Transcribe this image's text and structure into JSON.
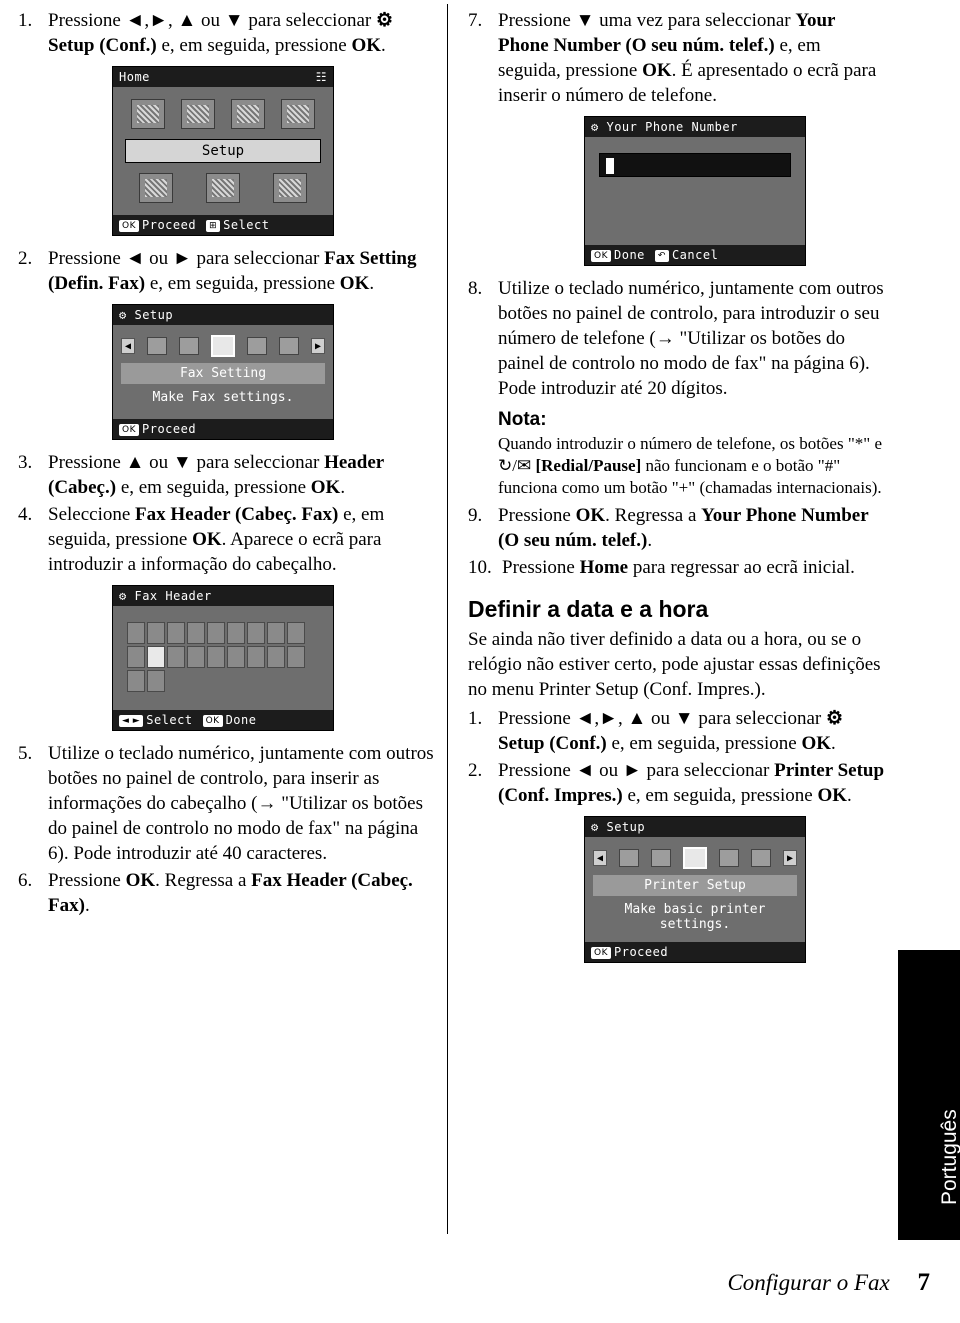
{
  "page": {
    "footer_title": "Configurar o Fax",
    "page_number": "7",
    "side_tab": "Português"
  },
  "left_column": {
    "steps": [
      {
        "num": "1.",
        "text_parts": [
          {
            "t": "Pressione ",
            "b": false
          },
          {
            "t": "◄",
            "b": true
          },
          {
            "t": ",",
            "b": false
          },
          {
            "t": "►",
            "b": true
          },
          {
            "t": ", ",
            "b": false
          },
          {
            "t": "▲",
            "b": true
          },
          {
            "t": " ou ",
            "b": false
          },
          {
            "t": "▼",
            "b": true
          },
          {
            "t": " para seleccionar ",
            "b": false
          },
          {
            "t": "⚙ Setup (Conf.)",
            "b": true
          },
          {
            "t": " e, em seguida, pressione ",
            "b": false
          },
          {
            "t": "OK",
            "b": true
          },
          {
            "t": ".",
            "b": false
          }
        ]
      },
      {
        "num": "2.",
        "text_parts": [
          {
            "t": "Pressione ",
            "b": false
          },
          {
            "t": "◄",
            "b": true
          },
          {
            "t": " ou ",
            "b": false
          },
          {
            "t": "►",
            "b": true
          },
          {
            "t": " para seleccionar ",
            "b": false
          },
          {
            "t": "Fax Setting (Defin. Fax)",
            "b": true
          },
          {
            "t": " e, em seguida, pressione ",
            "b": false
          },
          {
            "t": "OK",
            "b": true
          },
          {
            "t": ".",
            "b": false
          }
        ]
      },
      {
        "num": "3.",
        "text_parts": [
          {
            "t": "Pressione ",
            "b": false
          },
          {
            "t": "▲",
            "b": true
          },
          {
            "t": " ou ",
            "b": false
          },
          {
            "t": "▼",
            "b": true
          },
          {
            "t": " para seleccionar ",
            "b": false
          },
          {
            "t": "Header (Cabeç.)",
            "b": true
          },
          {
            "t": " e, em seguida, pressione ",
            "b": false
          },
          {
            "t": "OK",
            "b": true
          },
          {
            "t": ".",
            "b": false
          }
        ]
      },
      {
        "num": "4.",
        "text_parts": [
          {
            "t": "Seleccione ",
            "b": false
          },
          {
            "t": "Fax Header (Cabeç. Fax)",
            "b": true
          },
          {
            "t": " e, em seguida, pressione ",
            "b": false
          },
          {
            "t": "OK",
            "b": true
          },
          {
            "t": ". Aparece o ecrã para introduzir a informação do cabeçalho.",
            "b": false
          }
        ]
      },
      {
        "num": "5.",
        "text_parts": [
          {
            "t": "Utilize o teclado numérico, juntamente com outros botões no painel de controlo, para inserir as informações do cabeçalho (",
            "b": false
          },
          {
            "t": "→",
            "b": false
          },
          {
            "t": " \"Utilizar os botões do painel de controlo no modo de fax\" na página 6). Pode introduzir até 40 caracteres.",
            "b": false
          }
        ]
      },
      {
        "num": "6.",
        "text_parts": [
          {
            "t": "Pressione ",
            "b": false
          },
          {
            "t": "OK",
            "b": true
          },
          {
            "t": ". Regressa a ",
            "b": false
          },
          {
            "t": "Fax Header (Cabeç. Fax)",
            "b": true
          },
          {
            "t": ".",
            "b": false
          }
        ]
      }
    ],
    "lcd_home": {
      "title": "Home",
      "selected_label": "Setup",
      "foot_ok_key": "OK",
      "foot_ok_label": "Proceed",
      "foot_sel_key": "⊞",
      "foot_sel_label": "Select"
    },
    "lcd_setup": {
      "title": "Setup",
      "title_icon": "⚙",
      "heading": "Fax Setting",
      "description": "Make Fax settings.",
      "foot_ok_key": "OK",
      "foot_ok_label": "Proceed"
    },
    "lcd_fax_header": {
      "title": "Fax Header",
      "title_icon": "⚙",
      "foot_left_key": "◄ ►",
      "foot_left_label": "Select",
      "foot_ok_key": "OK",
      "foot_ok_label": "Done"
    }
  },
  "right_column": {
    "steps": [
      {
        "num": "7.",
        "text_parts": [
          {
            "t": "Pressione ",
            "b": false
          },
          {
            "t": "▼",
            "b": true
          },
          {
            "t": " uma vez para seleccionar ",
            "b": false
          },
          {
            "t": "Your Phone Number (O seu núm. telef.)",
            "b": true
          },
          {
            "t": " e, em seguida, pressione ",
            "b": false
          },
          {
            "t": "OK",
            "b": true
          },
          {
            "t": ". É apresentado o ecrã para inserir o número de telefone.",
            "b": false
          }
        ]
      },
      {
        "num": "8.",
        "text_parts": [
          {
            "t": "Utilize o teclado numérico, juntamente com outros botões no painel de controlo, para introduzir o seu número de telefone (",
            "b": false
          },
          {
            "t": "→",
            "b": false
          },
          {
            "t": " \"Utilizar os botões do painel de controlo no modo de fax\" na página 6). Pode introduzir até 20 dígitos.",
            "b": false
          }
        ]
      },
      {
        "num": "9.",
        "text_parts": [
          {
            "t": "Pressione ",
            "b": false
          },
          {
            "t": "OK",
            "b": true
          },
          {
            "t": ". Regressa a ",
            "b": false
          },
          {
            "t": "Your Phone Number (O seu núm. telef.)",
            "b": true
          },
          {
            "t": ".",
            "b": false
          }
        ]
      },
      {
        "num": "10.",
        "text_parts": [
          {
            "t": "Pressione ",
            "b": false
          },
          {
            "t": "Home",
            "b": true
          },
          {
            "t": " para regressar ao ecrã inicial.",
            "b": false
          }
        ]
      }
    ],
    "note": {
      "heading": "Nota:",
      "text_parts": [
        {
          "t": "Quando introduzir o número de telefone, os botões \"*\" e ",
          "b": false
        },
        {
          "t": "↻/✉",
          "b": false
        },
        {
          "t": " ",
          "b": false
        },
        {
          "t": "[Redial/Pause]",
          "b": true
        },
        {
          "t": " não funcionam e o botão \"#\" funciona como um botão \"+\" (chamadas internacionais).",
          "b": false
        }
      ]
    },
    "section": {
      "heading": "Definir a data e a hora",
      "intro": "Se ainda não tiver definido a data ou a hora, ou se o relógio não estiver certo, pode ajustar essas definições no menu Printer Setup (Conf. Impres.).",
      "steps": [
        {
          "num": "1.",
          "text_parts": [
            {
              "t": "Pressione ",
              "b": false
            },
            {
              "t": "◄",
              "b": true
            },
            {
              "t": ",",
              "b": false
            },
            {
              "t": "►",
              "b": true
            },
            {
              "t": ", ",
              "b": false
            },
            {
              "t": "▲",
              "b": true
            },
            {
              "t": " ou ",
              "b": false
            },
            {
              "t": "▼",
              "b": true
            },
            {
              "t": " para seleccionar ",
              "b": false
            },
            {
              "t": "⚙ Setup (Conf.)",
              "b": true
            },
            {
              "t": " e, em seguida, pressione ",
              "b": false
            },
            {
              "t": "OK",
              "b": true
            },
            {
              "t": ".",
              "b": false
            }
          ]
        },
        {
          "num": "2.",
          "text_parts": [
            {
              "t": "Pressione ",
              "b": false
            },
            {
              "t": "◄",
              "b": true
            },
            {
              "t": " ou ",
              "b": false
            },
            {
              "t": "►",
              "b": true
            },
            {
              "t": " para seleccionar ",
              "b": false
            },
            {
              "t": "Printer Setup (Conf. Impres.)",
              "b": true
            },
            {
              "t": " e, em seguida, pressione ",
              "b": false
            },
            {
              "t": "OK",
              "b": true
            },
            {
              "t": ".",
              "b": false
            }
          ]
        }
      ]
    },
    "lcd_phone": {
      "title": "Your Phone Number",
      "title_icon": "⚙",
      "foot_ok_key": "OK",
      "foot_ok_label": "Done",
      "foot_back_key": "↶",
      "foot_back_label": "Cancel"
    },
    "lcd_printer_setup": {
      "title": "Setup",
      "title_icon": "⚙",
      "heading": "Printer Setup",
      "description_line1": "Make basic printer",
      "description_line2": "settings.",
      "foot_ok_key": "OK",
      "foot_ok_label": "Proceed"
    }
  }
}
